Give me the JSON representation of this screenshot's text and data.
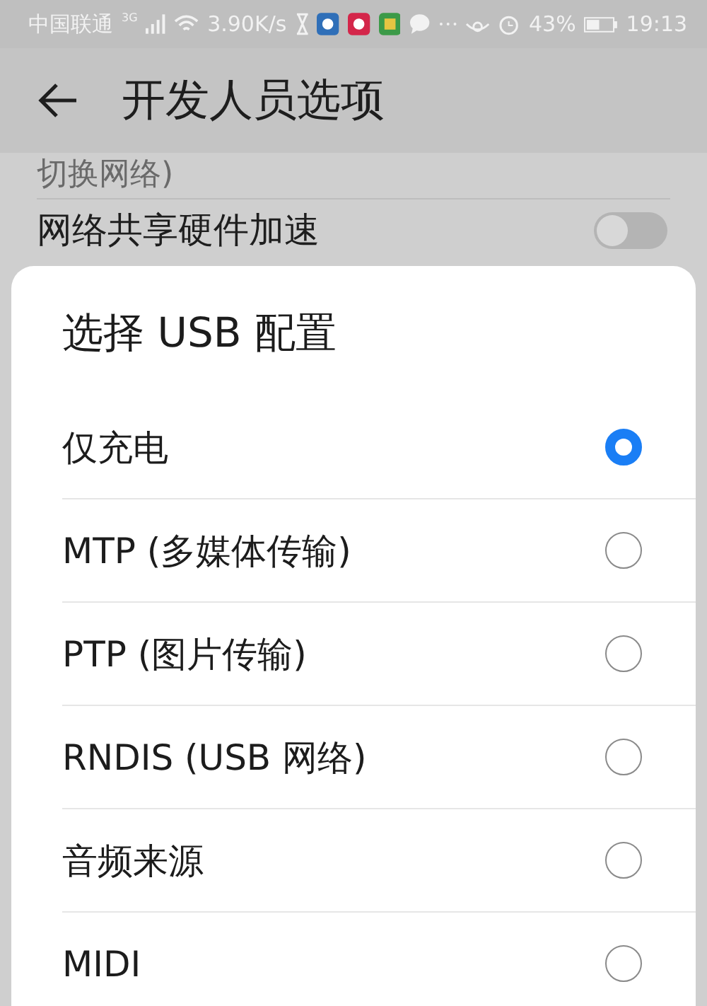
{
  "status_bar": {
    "carrier": "中国联通",
    "network": "3G",
    "speed": "3.90K/s",
    "battery": "43%",
    "time": "19:13"
  },
  "app_bar": {
    "title": "开发人员选项"
  },
  "settings": [
    {
      "kind": "text",
      "label": "切换网络)"
    },
    {
      "kind": "toggle",
      "label": "网络共享硬件加速",
      "on": false
    }
  ],
  "dialog": {
    "title": "选择 USB 配置",
    "options": [
      {
        "label": "仅充电",
        "selected": true
      },
      {
        "label": "MTP (多媒体传输)",
        "selected": false
      },
      {
        "label": "PTP (图片传输)",
        "selected": false
      },
      {
        "label": "RNDIS (USB 网络)",
        "selected": false
      },
      {
        "label": "音频来源",
        "selected": false
      },
      {
        "label": "MIDI",
        "selected": false
      }
    ]
  }
}
